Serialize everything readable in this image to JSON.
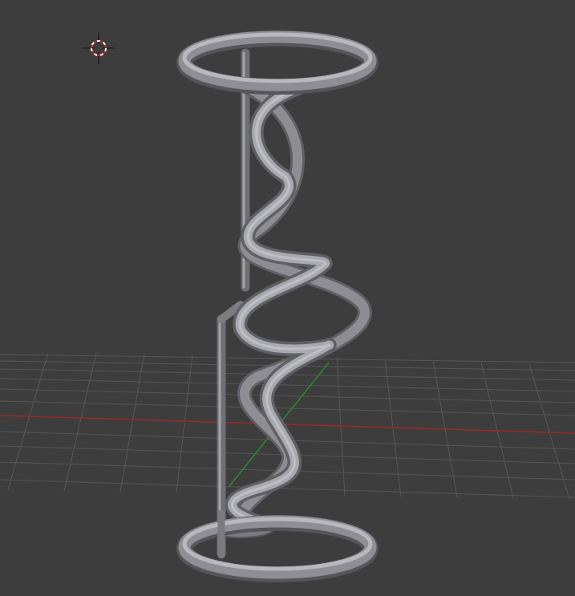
{
  "viewport": {
    "background_color": "#3d3d3d",
    "grid_line_color": "#5a5a5a",
    "x_axis_color": "#9a2b2b",
    "y_axis_color": "#2d8a2d",
    "object_color": "#8a8a90",
    "object_highlight_color": "#b4b4bb",
    "object_shadow_color": "#55555a",
    "cursor_colors": [
      "#ffffff",
      "#cc2222"
    ],
    "icons": [
      "3d-cursor-icon"
    ]
  }
}
